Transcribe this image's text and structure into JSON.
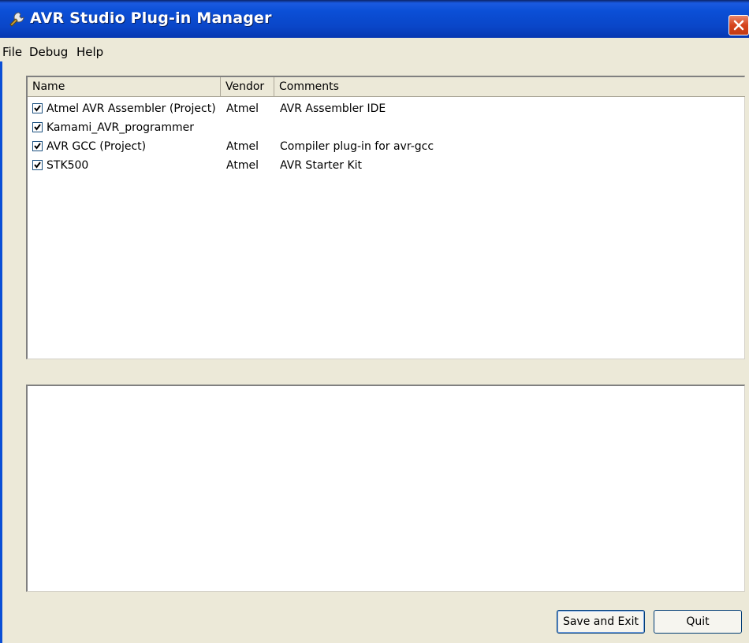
{
  "window": {
    "title": "AVR Studio Plug-in Manager",
    "title_icon": "wrench-icon",
    "close_icon": "close-icon",
    "accent_color": "#0b4fd6",
    "close_color": "#d6431c"
  },
  "menu": {
    "items": [
      "File",
      "Debug",
      "Help"
    ]
  },
  "plugin_list": {
    "columns": [
      "Name",
      "Vendor",
      "Comments"
    ],
    "rows": [
      {
        "checked": true,
        "name": "Atmel AVR Assembler (Project)",
        "vendor": "Atmel",
        "comments": "AVR Assembler IDE"
      },
      {
        "checked": true,
        "name": "Kamami_AVR_programmer",
        "vendor": "",
        "comments": ""
      },
      {
        "checked": true,
        "name": "AVR GCC (Project)",
        "vendor": "Atmel",
        "comments": "Compiler plug-in for avr-gcc"
      },
      {
        "checked": true,
        "name": "STK500",
        "vendor": "Atmel",
        "comments": "AVR Starter Kit"
      }
    ]
  },
  "details": {
    "text": ""
  },
  "buttons": {
    "save_label": "Save and Exit",
    "quit_label": "Quit"
  }
}
